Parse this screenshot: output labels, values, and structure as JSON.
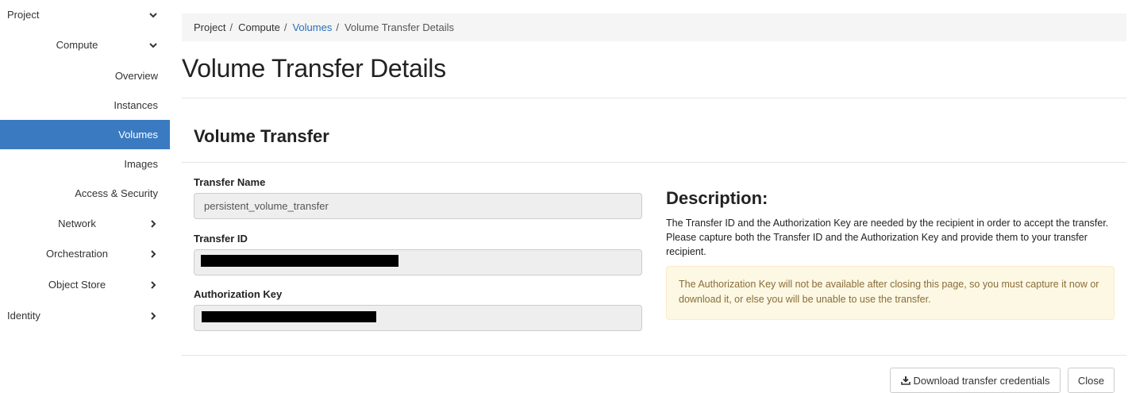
{
  "sidebar": {
    "items": [
      {
        "label": "Project"
      },
      {
        "label": "Compute"
      },
      {
        "label": "Overview"
      },
      {
        "label": "Instances"
      },
      {
        "label": "Volumes"
      },
      {
        "label": "Images"
      },
      {
        "label": "Access & Security"
      },
      {
        "label": "Network"
      },
      {
        "label": "Orchestration"
      },
      {
        "label": "Object Store"
      },
      {
        "label": "Identity"
      }
    ],
    "active_item": "Volumes",
    "active_color": "#3a7ac1"
  },
  "breadcrumb": {
    "items": [
      "Project",
      "Compute",
      "Volumes",
      "Volume Transfer Details"
    ],
    "separator": "/"
  },
  "page_title": "Volume Transfer Details",
  "section_title": "Volume Transfer",
  "fields": {
    "transfer_name": {
      "label": "Transfer Name",
      "value": "persistent_volume_transfer"
    },
    "transfer_id": {
      "label": "Transfer ID",
      "value": ""
    },
    "authorization_key": {
      "label": "Authorization Key",
      "value": ""
    }
  },
  "description": {
    "title": "Description:",
    "text": "The Transfer ID and the Authorization Key are needed by the recipient in order to accept the transfer. Please capture both the Transfer ID and the Authorization Key and provide them to your transfer recipient.",
    "warning": "The Authorization Key will not be available after closing this page, so you must capture it now or download it, or else you will be unable to use the transfer."
  },
  "buttons": {
    "download_label": "Download transfer credentials",
    "close_label": "Close"
  }
}
